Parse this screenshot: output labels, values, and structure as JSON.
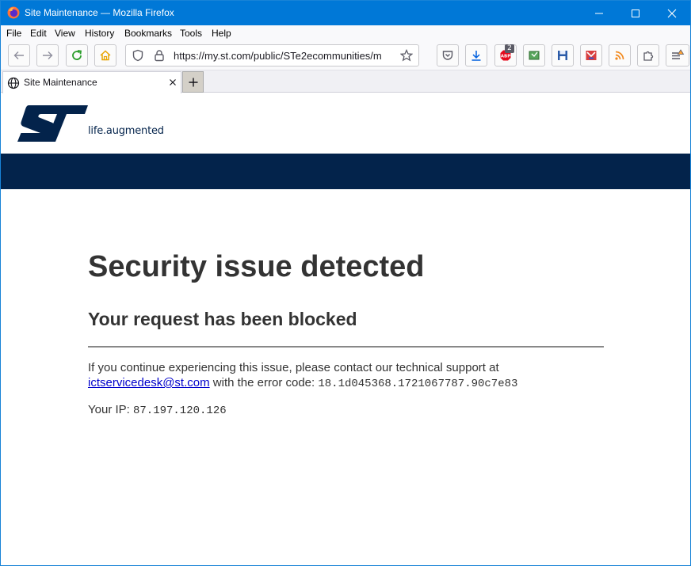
{
  "window": {
    "title": "Site Maintenance — Mozilla Firefox",
    "accent_color": "#0078d7"
  },
  "menu": {
    "items": [
      "File",
      "Edit",
      "View",
      "History",
      "Bookmarks",
      "Tools",
      "Help"
    ]
  },
  "toolbar": {
    "url": "https://my.st.com/public/STe2ecommunities/m",
    "adblock_badge": "2",
    "icons": [
      "back-icon",
      "forward-icon",
      "reload-icon",
      "home-icon",
      "shield-icon",
      "lock-icon",
      "bookmark-star-icon",
      "pocket-icon",
      "download-icon",
      "adblock-icon",
      "screenshot-icon",
      "save-icon",
      "mail-icon",
      "rss-icon",
      "extensions-icon",
      "app-menu-icon"
    ]
  },
  "tabs": {
    "active_title": "Site Maintenance"
  },
  "page": {
    "brand_tagline": "life.augmented",
    "brand_color": "#03234b",
    "heading": "Security issue detected",
    "subheading": "Your request has been blocked",
    "message_prefix": "If you continue experiencing this issue, please contact our technical support at",
    "support_email": "ictservicedesk@st.com",
    "message_middle": "with the error code:",
    "error_code": "18.1d045368.1721067787.90c7e83",
    "ip_label": "Your IP:",
    "ip_value": "87.197.120.126"
  }
}
